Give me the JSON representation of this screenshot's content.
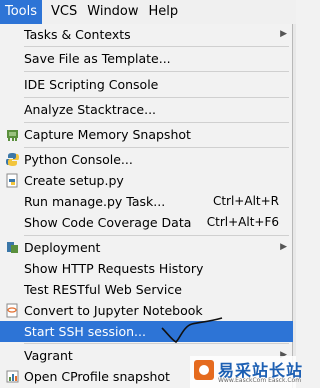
{
  "menubar": {
    "items": [
      {
        "label": "Tools",
        "mnemonic": "T"
      },
      {
        "label": "VCS",
        "mnemonic": "S"
      },
      {
        "label": "Window",
        "mnemonic": "W"
      },
      {
        "label": "Help",
        "mnemonic": "H"
      }
    ]
  },
  "menu": {
    "items": [
      {
        "label": "Tasks & Contexts"
      },
      {
        "label": "Save File as Template..."
      },
      {
        "label": "IDE Scripting Console"
      },
      {
        "label": "Analyze Stacktrace..."
      },
      {
        "label": "Capture Memory Snapshot",
        "icon": "memory-snapshot-icon"
      },
      {
        "label": "Python Console...",
        "icon": "python-icon"
      },
      {
        "label": "Create setup.py",
        "icon": "python-file-icon"
      },
      {
        "label": "Run manage.py Task...",
        "shortcut": "Ctrl+Alt+R"
      },
      {
        "label": "Show Code Coverage Data",
        "shortcut": "Ctrl+Alt+F6"
      },
      {
        "label": "Deployment",
        "icon": "deployment-icon"
      },
      {
        "label": "Show HTTP Requests History"
      },
      {
        "label": "Test RESTful Web Service"
      },
      {
        "label": "Convert to Jupyter Notebook",
        "icon": "jupyter-icon"
      },
      {
        "label": "Start SSH session..."
      },
      {
        "label": "Vagrant"
      },
      {
        "label": "Open CProfile snapshot",
        "icon": "cprofile-icon"
      }
    ]
  },
  "watermark": {
    "title": "易采站长站",
    "subtitle": "Www.EasckCom  Easck.Com"
  },
  "colors": {
    "selection": "#2d74d6",
    "menu_bg": "#f2f2f2"
  }
}
